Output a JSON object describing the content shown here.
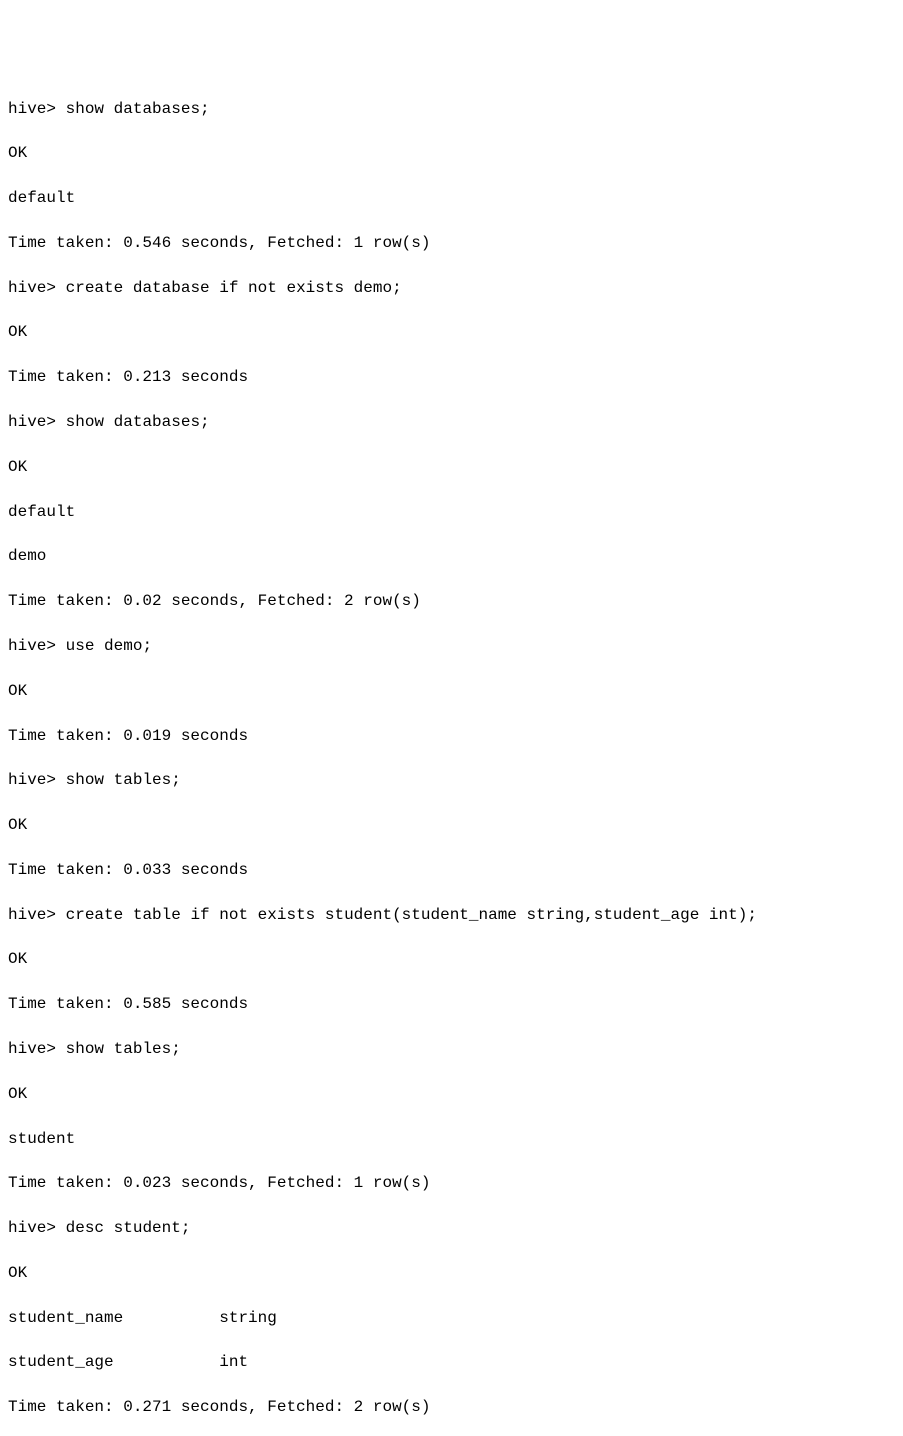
{
  "prompt": "hive>",
  "ok": "OK",
  "lines": {
    "l1_cmd": "show databases;",
    "l3": "default",
    "l4": "Time taken: 0.546 seconds, Fetched: 1 row(s)",
    "l5_cmd": "create database if not exists demo;",
    "l7": "Time taken: 0.213 seconds",
    "l8_cmd": "show databases;",
    "l10": "default",
    "l11": "demo",
    "l12": "Time taken: 0.02 seconds, Fetched: 2 row(s)",
    "l13_cmd": "use demo;",
    "l15": "Time taken: 0.019 seconds",
    "l16_cmd": "show tables;",
    "l18": "Time taken: 0.033 seconds",
    "l19_cmd": "create table if not exists student(student_name string,student_age int);",
    "l21": "Time taken: 0.585 seconds",
    "l22_cmd": "show tables;",
    "l24": "student",
    "l25": "Time taken: 0.023 seconds, Fetched: 1 row(s)",
    "l26_cmd": "desc student;",
    "l28_c1": "student_name",
    "l28_c2": "string",
    "l29_c1": "student_age",
    "l29_c2": "int",
    "l30": "Time taken: 0.271 seconds, Fetched: 2 row(s)"
  }
}
